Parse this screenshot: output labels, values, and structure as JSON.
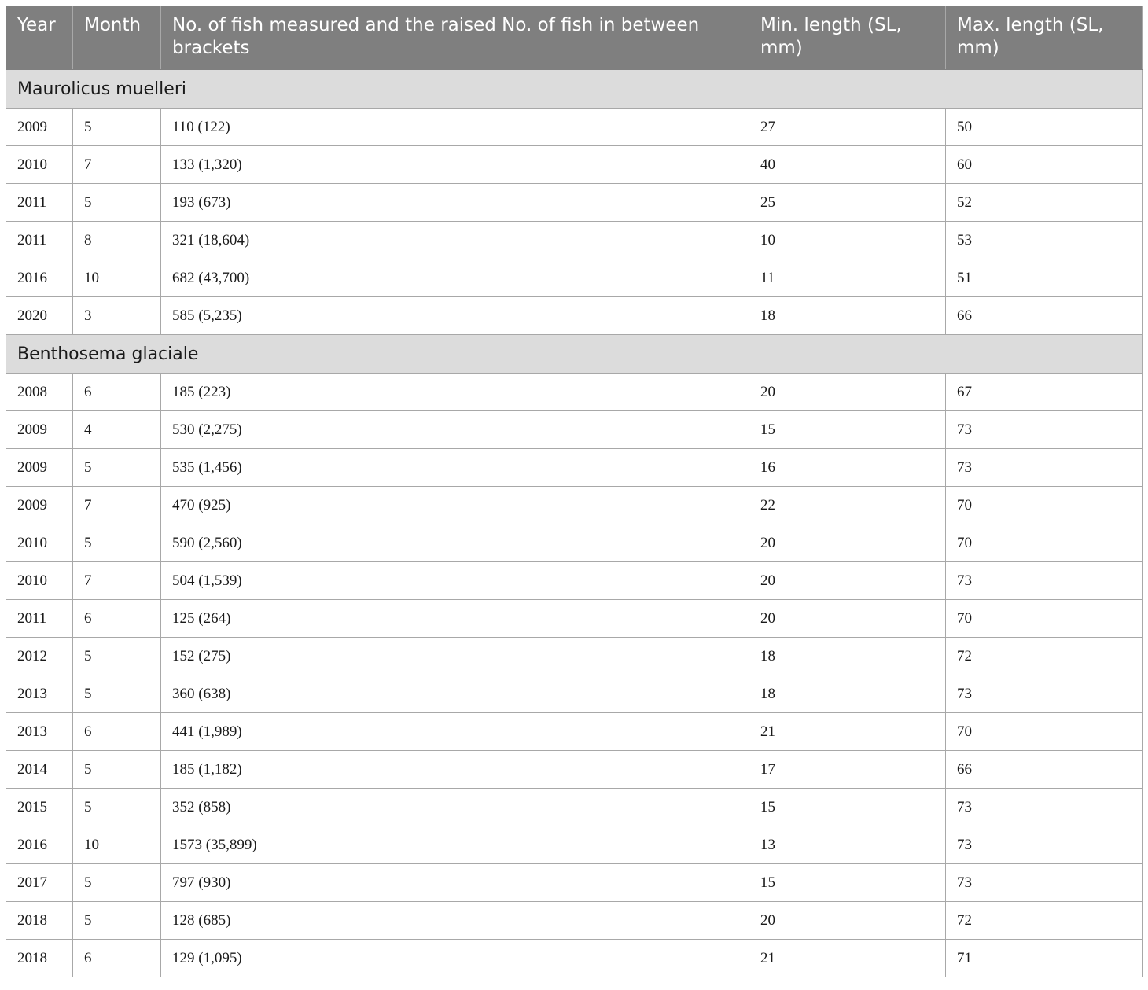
{
  "table": {
    "headers": {
      "year": "Year",
      "month": "Month",
      "fish_count": "No. of fish measured and the raised No. of fish in between brackets",
      "min_length": "Min. length (SL, mm)",
      "max_length": "Max. length (SL, mm)"
    },
    "groups": [
      {
        "species": "Maurolicus muelleri",
        "rows": [
          {
            "year": "2009",
            "month": "5",
            "fish": "110 (122)",
            "min": "27",
            "max": "50"
          },
          {
            "year": "2010",
            "month": "7",
            "fish": "133 (1,320)",
            "min": "40",
            "max": "60"
          },
          {
            "year": "2011",
            "month": "5",
            "fish": "193 (673)",
            "min": "25",
            "max": "52"
          },
          {
            "year": "2011",
            "month": "8",
            "fish": "321 (18,604)",
            "min": "10",
            "max": "53"
          },
          {
            "year": "2016",
            "month": "10",
            "fish": "682 (43,700)",
            "min": "11",
            "max": "51"
          },
          {
            "year": "2020",
            "month": "3",
            "fish": "585 (5,235)",
            "min": "18",
            "max": "66"
          }
        ]
      },
      {
        "species": "Benthosema glaciale",
        "rows": [
          {
            "year": "2008",
            "month": "6",
            "fish": "185 (223)",
            "min": "20",
            "max": "67"
          },
          {
            "year": "2009",
            "month": "4",
            "fish": "530 (2,275)",
            "min": "15",
            "max": "73"
          },
          {
            "year": "2009",
            "month": "5",
            "fish": "535 (1,456)",
            "min": "16",
            "max": "73"
          },
          {
            "year": "2009",
            "month": "7",
            "fish": "470 (925)",
            "min": "22",
            "max": "70"
          },
          {
            "year": "2010",
            "month": "5",
            "fish": "590 (2,560)",
            "min": "20",
            "max": "70"
          },
          {
            "year": "2010",
            "month": "7",
            "fish": "504 (1,539)",
            "min": "20",
            "max": "73"
          },
          {
            "year": "2011",
            "month": "6",
            "fish": "125 (264)",
            "min": "20",
            "max": "70"
          },
          {
            "year": "2012",
            "month": "5",
            "fish": "152 (275)",
            "min": "18",
            "max": "72"
          },
          {
            "year": "2013",
            "month": "5",
            "fish": "360 (638)",
            "min": "18",
            "max": "73"
          },
          {
            "year": "2013",
            "month": "6",
            "fish": "441 (1,989)",
            "min": "21",
            "max": "70"
          },
          {
            "year": "2014",
            "month": "5",
            "fish": "185 (1,182)",
            "min": "17",
            "max": "66"
          },
          {
            "year": "2015",
            "month": "5",
            "fish": "352 (858)",
            "min": "15",
            "max": "73"
          },
          {
            "year": "2016",
            "month": "10",
            "fish": "1573 (35,899)",
            "min": "13",
            "max": "73"
          },
          {
            "year": "2017",
            "month": "5",
            "fish": "797 (930)",
            "min": "15",
            "max": "73"
          },
          {
            "year": "2018",
            "month": "5",
            "fish": "128 (685)",
            "min": "20",
            "max": "72"
          },
          {
            "year": "2018",
            "month": "6",
            "fish": "129 (1,095)",
            "min": "21",
            "max": "71"
          }
        ]
      }
    ]
  }
}
